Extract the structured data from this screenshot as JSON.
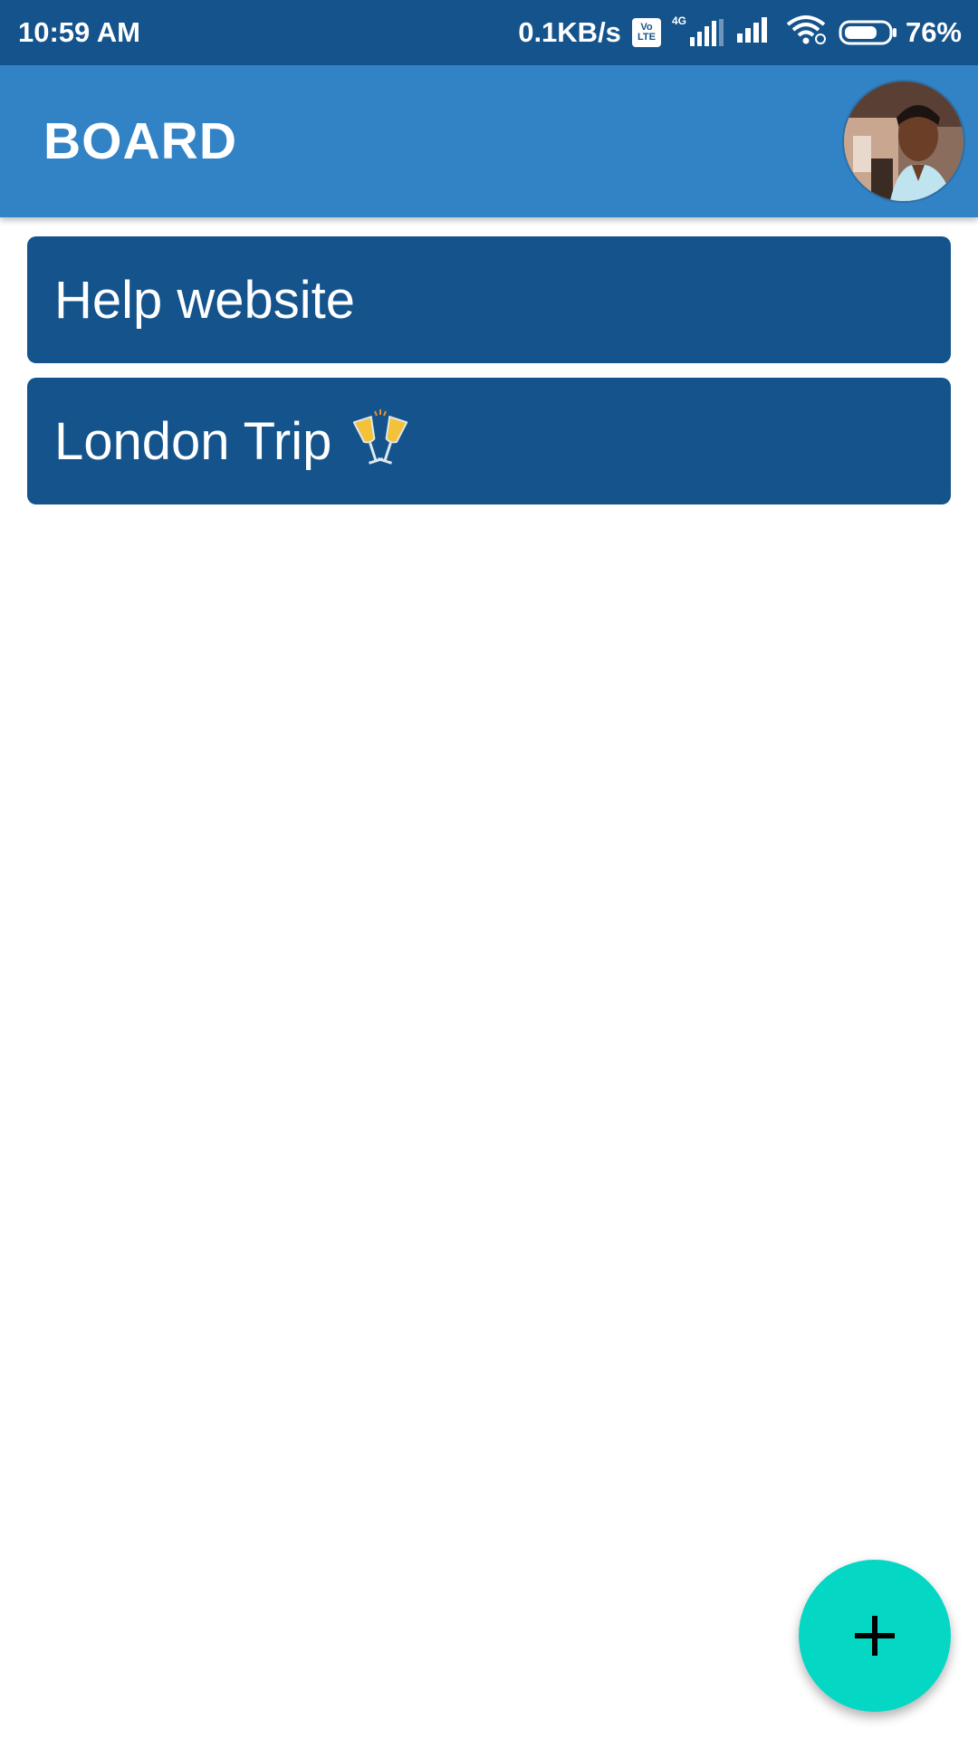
{
  "status_bar": {
    "time": "10:59 AM",
    "network_speed": "0.1KB/s",
    "volte_top": "Vo",
    "volte_bottom": "LTE",
    "network_type": "4G",
    "battery_percent": "76%",
    "battery_level": 0.76
  },
  "app_bar": {
    "title": "BOARD",
    "avatar_icon": "user-avatar"
  },
  "boards": [
    {
      "title": "Help website",
      "icon": ""
    },
    {
      "title": "London Trip",
      "icon": "clinking-glasses-icon"
    }
  ],
  "fab": {
    "icon": "plus-icon",
    "color": "#05d7c5"
  },
  "colors": {
    "status_bar": "#14538b",
    "app_bar": "#3282c6",
    "card": "#14538b",
    "fab": "#05d7c5"
  }
}
